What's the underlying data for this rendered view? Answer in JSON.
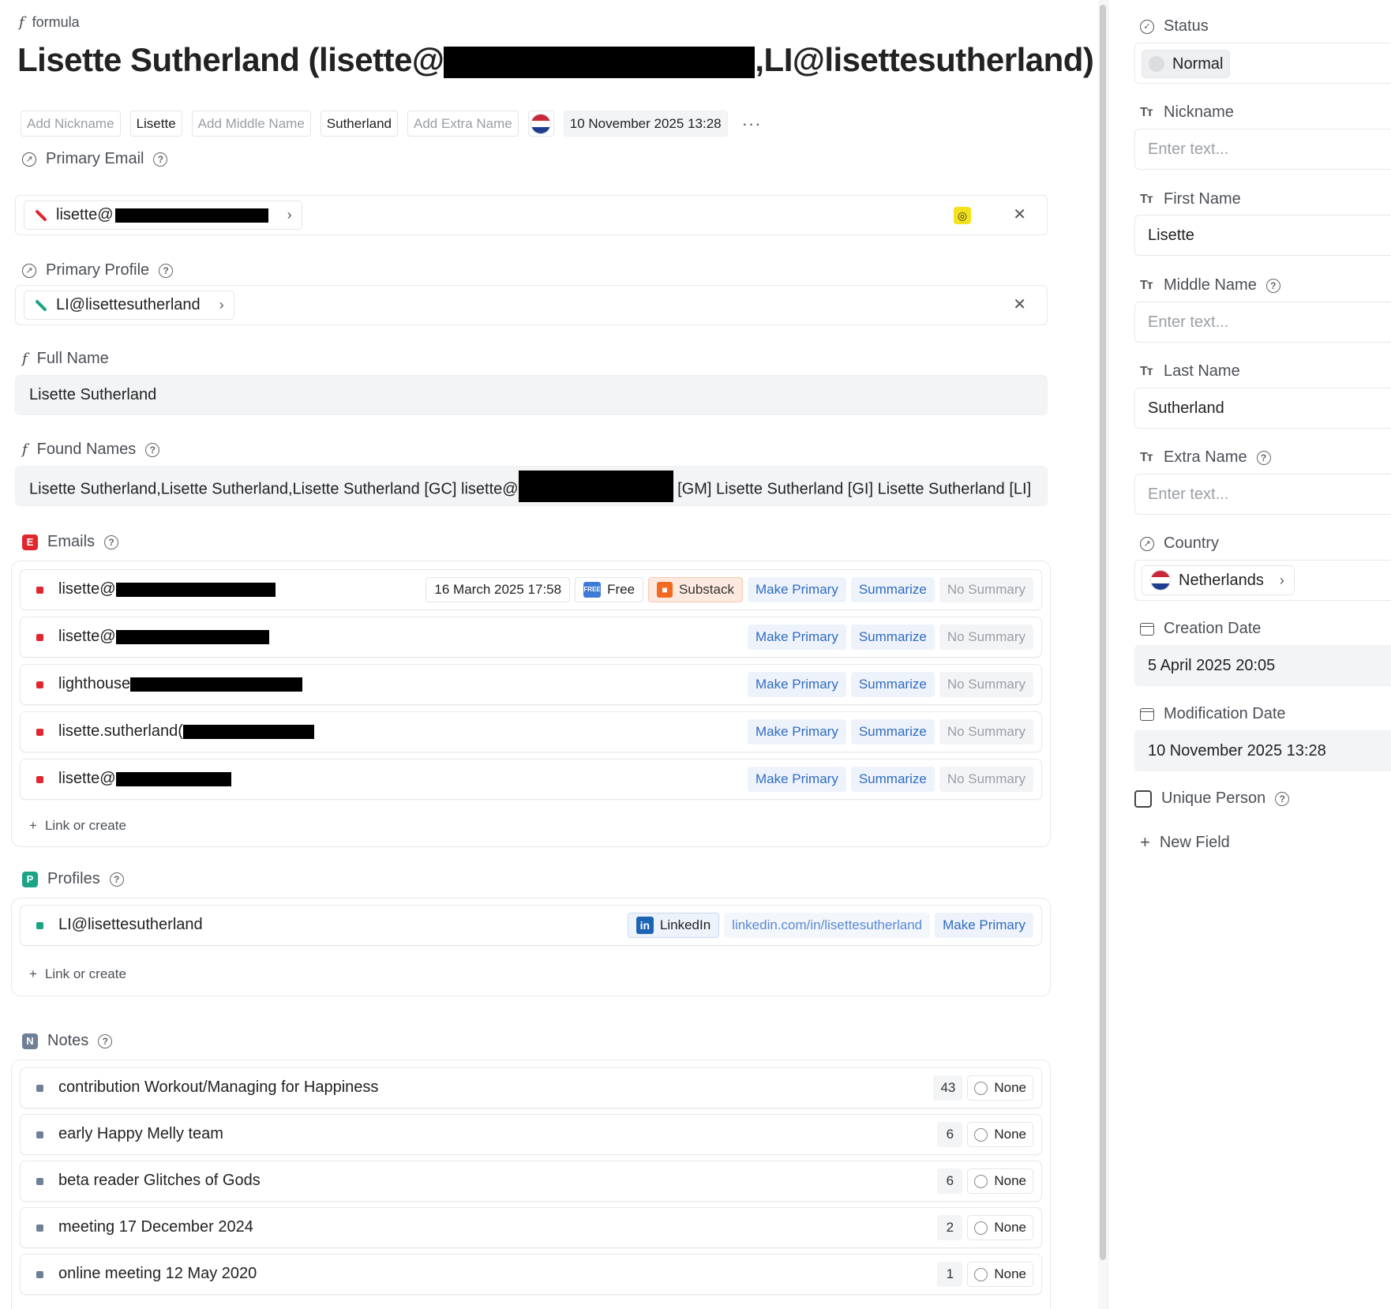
{
  "header": {
    "crumb": "formula",
    "title_prefix": "Lisette Sutherland (lisette@",
    "title_suffix": ",LI@lisettesutherland)"
  },
  "name_chips": {
    "add_nickname": "Add Nickname",
    "first_name": "Lisette",
    "add_middle_name": "Add Middle Name",
    "last_name": "Sutherland",
    "add_extra_name": "Add Extra Name",
    "date": "10 November 2025 13:28",
    "more": "···"
  },
  "primary_email": {
    "label": "Primary Email",
    "value_prefix": "lisette@",
    "accent": "#e0262f"
  },
  "primary_profile": {
    "label": "Primary Profile",
    "value": "LI@lisettesutherland",
    "accent": "#1aa385"
  },
  "full_name": {
    "label": "Full Name",
    "value": "Lisette Sutherland"
  },
  "found_names": {
    "label": "Found Names",
    "value_prefix": "Lisette Sutherland,Lisette Sutherland,Lisette Sutherland [GC] lisette@",
    "value_suffix": "[GM] Lisette Sutherland [GI] Lisette Sutherland [LI]"
  },
  "emails": {
    "badge": "E",
    "label": "Emails",
    "color": "#e0262f",
    "rows": [
      {
        "text": "lisette@",
        "date": "16 March 2025 17:58",
        "free": "Free",
        "substack": "Substack"
      },
      {
        "text": "lisette@"
      },
      {
        "text": "lighthouse"
      },
      {
        "text": "lisette.sutherland("
      },
      {
        "text": "lisette@"
      }
    ],
    "make_primary": "Make Primary",
    "summarize": "Summarize",
    "no_summary": "No Summary",
    "link_or_create": "Link or create"
  },
  "profiles": {
    "badge": "P",
    "label": "Profiles",
    "color": "#1aa385",
    "rows": [
      {
        "text": "LI@lisettesutherland",
        "network": "LinkedIn",
        "url": "linkedin.com/in/lisettesutherland",
        "make_primary": "Make Primary"
      }
    ],
    "link_or_create": "Link or create"
  },
  "notes": {
    "badge": "N",
    "label": "Notes",
    "color": "#6e7f96",
    "rows": [
      {
        "text": "contribution Workout/Managing for Happiness",
        "count": "43",
        "status": "None"
      },
      {
        "text": "early Happy Melly team",
        "count": "6",
        "status": "None"
      },
      {
        "text": "beta reader Glitches of Gods",
        "count": "6",
        "status": "None"
      },
      {
        "text": "meeting 17 December 2024",
        "count": "2",
        "status": "None"
      },
      {
        "text": "online meeting 12 May 2020",
        "count": "1",
        "status": "None"
      }
    ]
  },
  "sidebar": {
    "status": {
      "label": "Status",
      "value": "Normal"
    },
    "nickname": {
      "label": "Nickname",
      "placeholder": "Enter text..."
    },
    "first_name": {
      "label": "First Name",
      "value": "Lisette"
    },
    "middle_name": {
      "label": "Middle Name",
      "placeholder": "Enter text..."
    },
    "last_name": {
      "label": "Last Name",
      "value": "Sutherland"
    },
    "extra_name": {
      "label": "Extra Name",
      "placeholder": "Enter text..."
    },
    "country": {
      "label": "Country",
      "value": "Netherlands"
    },
    "creation_date": {
      "label": "Creation Date",
      "value": "5 April 2025 20:05"
    },
    "modification_date": {
      "label": "Modification Date",
      "value": "10 November 2025 13:28"
    },
    "unique_person": {
      "label": "Unique Person",
      "checked": false
    },
    "new_field": "New Field"
  },
  "colors": {
    "flag_red": "#c8283a",
    "flag_white": "#ffffff",
    "flag_blue": "#1e3f8f",
    "link_blue": "#2f6bc2"
  }
}
